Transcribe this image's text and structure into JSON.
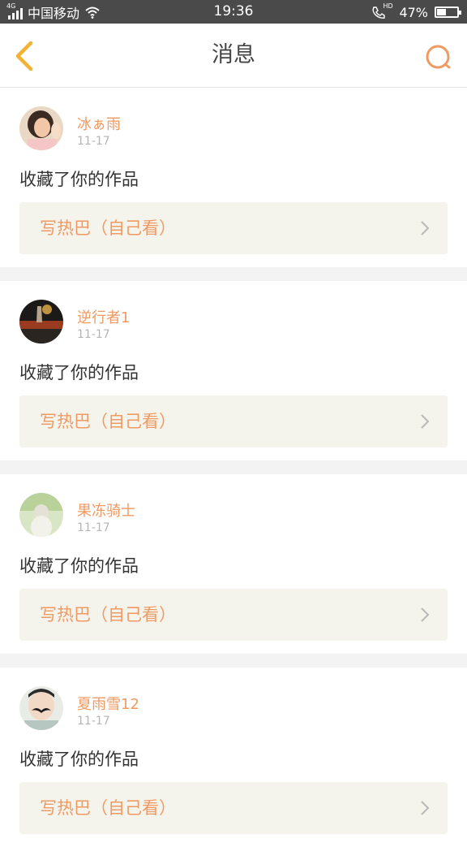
{
  "status_bar": {
    "network": "4G",
    "carrier": "中国移动",
    "time": "19:36",
    "hd": "HD",
    "battery_percent_label": "47%",
    "battery_level": 0.47
  },
  "header": {
    "title": "消息"
  },
  "messages": [
    {
      "name": "冰ぁ雨",
      "date": "11-17",
      "content": "收藏了你的作品",
      "work_title": "写热巴（自己看）"
    },
    {
      "name": "逆行者1",
      "date": "11-17",
      "content": "收藏了你的作品",
      "work_title": "写热巴（自己看）"
    },
    {
      "name": "果冻骑士",
      "date": "11-17",
      "content": "收藏了你的作品",
      "work_title": "写热巴（自己看）"
    },
    {
      "name": "夏雨雪12",
      "date": "11-17",
      "content": "收藏了你的作品",
      "work_title": "写热巴（自己看）"
    }
  ],
  "colors": {
    "accent": "#f09a63",
    "back_arrow": "#f2b233",
    "card_bg": "#f4f4ed"
  }
}
